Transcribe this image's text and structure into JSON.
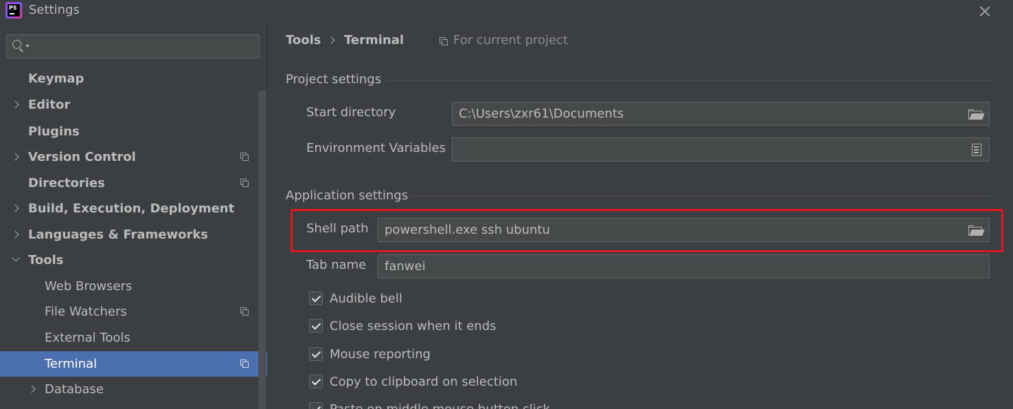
{
  "window": {
    "title": "Settings",
    "app_logo_text": "PS"
  },
  "sidebar": {
    "search": {
      "value": "",
      "placeholder": ""
    },
    "items": [
      {
        "label": "Keymap",
        "expander": "none",
        "bold": true,
        "level": 0,
        "project_icon": false,
        "selected": false
      },
      {
        "label": "Editor",
        "expander": "collapsed",
        "bold": true,
        "level": 0,
        "project_icon": false,
        "selected": false
      },
      {
        "label": "Plugins",
        "expander": "none",
        "bold": true,
        "level": 0,
        "project_icon": false,
        "selected": false
      },
      {
        "label": "Version Control",
        "expander": "collapsed",
        "bold": true,
        "level": 0,
        "project_icon": true,
        "selected": false
      },
      {
        "label": "Directories",
        "expander": "none",
        "bold": true,
        "level": 0,
        "project_icon": true,
        "selected": false
      },
      {
        "label": "Build, Execution, Deployment",
        "expander": "collapsed",
        "bold": true,
        "level": 0,
        "project_icon": false,
        "selected": false
      },
      {
        "label": "Languages & Frameworks",
        "expander": "collapsed",
        "bold": true,
        "level": 0,
        "project_icon": false,
        "selected": false
      },
      {
        "label": "Tools",
        "expander": "expanded",
        "bold": true,
        "level": 0,
        "project_icon": false,
        "selected": false
      },
      {
        "label": "Web Browsers",
        "expander": "none",
        "bold": false,
        "level": 1,
        "project_icon": false,
        "selected": false
      },
      {
        "label": "File Watchers",
        "expander": "none",
        "bold": false,
        "level": 1,
        "project_icon": true,
        "selected": false
      },
      {
        "label": "External Tools",
        "expander": "none",
        "bold": false,
        "level": 1,
        "project_icon": false,
        "selected": false
      },
      {
        "label": "Terminal",
        "expander": "none",
        "bold": false,
        "level": 1,
        "project_icon": true,
        "selected": true
      },
      {
        "label": "Database",
        "expander": "collapsed",
        "bold": false,
        "level": 1,
        "project_icon": false,
        "selected": false
      }
    ]
  },
  "main": {
    "breadcrumb": [
      "Tools",
      "Terminal"
    ],
    "scope_text": "For current project",
    "project_settings": {
      "title": "Project settings",
      "start_directory": {
        "label": "Start directory",
        "value": "C:\\Users\\zxr61\\Documents"
      },
      "env_vars": {
        "label": "Environment Variables",
        "value": ""
      }
    },
    "application_settings": {
      "title": "Application settings",
      "shell_path": {
        "label": "Shell path",
        "value": "powershell.exe ssh ubuntu"
      },
      "tab_name": {
        "label": "Tab name",
        "value": "fanwei"
      },
      "checkboxes": [
        {
          "label": "Audible bell",
          "checked": true
        },
        {
          "label": "Close session when it ends",
          "checked": true
        },
        {
          "label": "Mouse reporting",
          "checked": true
        },
        {
          "label": "Copy to clipboard on selection",
          "checked": true
        },
        {
          "label": "Paste on middle mouse button click",
          "checked": true
        }
      ]
    }
  },
  "colors": {
    "background": "#3c3f41",
    "selection": "#4b6eaf",
    "field_background": "#45494a",
    "highlight": "#e3151d",
    "text": "#bbbbbb"
  }
}
